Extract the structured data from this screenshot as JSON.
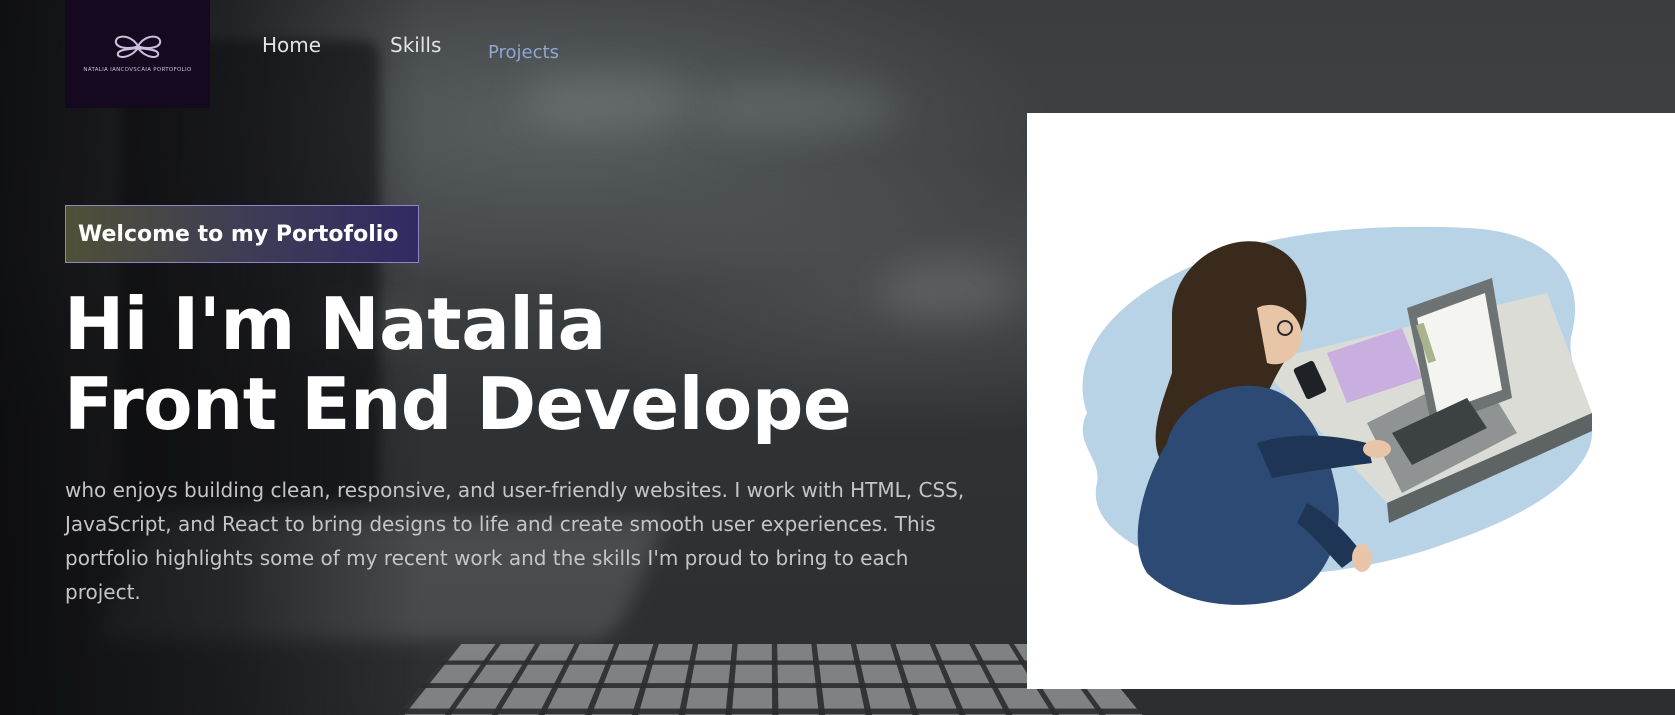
{
  "header": {
    "logo_text": "NATALIA IANCOVSCAIA PORTOFOLIO",
    "nav": {
      "home": "Home",
      "skills": "Skills",
      "projects": "Projects"
    }
  },
  "hero": {
    "badge": "Welcome to my Portofolio",
    "title_line1": "Hi I'm Natalia",
    "title_line2": "Front End Develope",
    "description": "who enjoys building clean, responsive, and user-friendly websites. I work with HTML, CSS, JavaScript, and React to bring designs to life and create smooth user experiences. This portfolio highlights some of my recent work and the skills I'm proud to bring to each project."
  },
  "colors": {
    "logo_bg": "#14091f",
    "nav_text": "#e3e3e3",
    "nav_active": "#8fa7d1",
    "badge_border": "#8c86c8",
    "title": "#ffffff",
    "description": "#c5c5c5"
  },
  "icons": {
    "logo": "butterfly-logo-icon"
  }
}
